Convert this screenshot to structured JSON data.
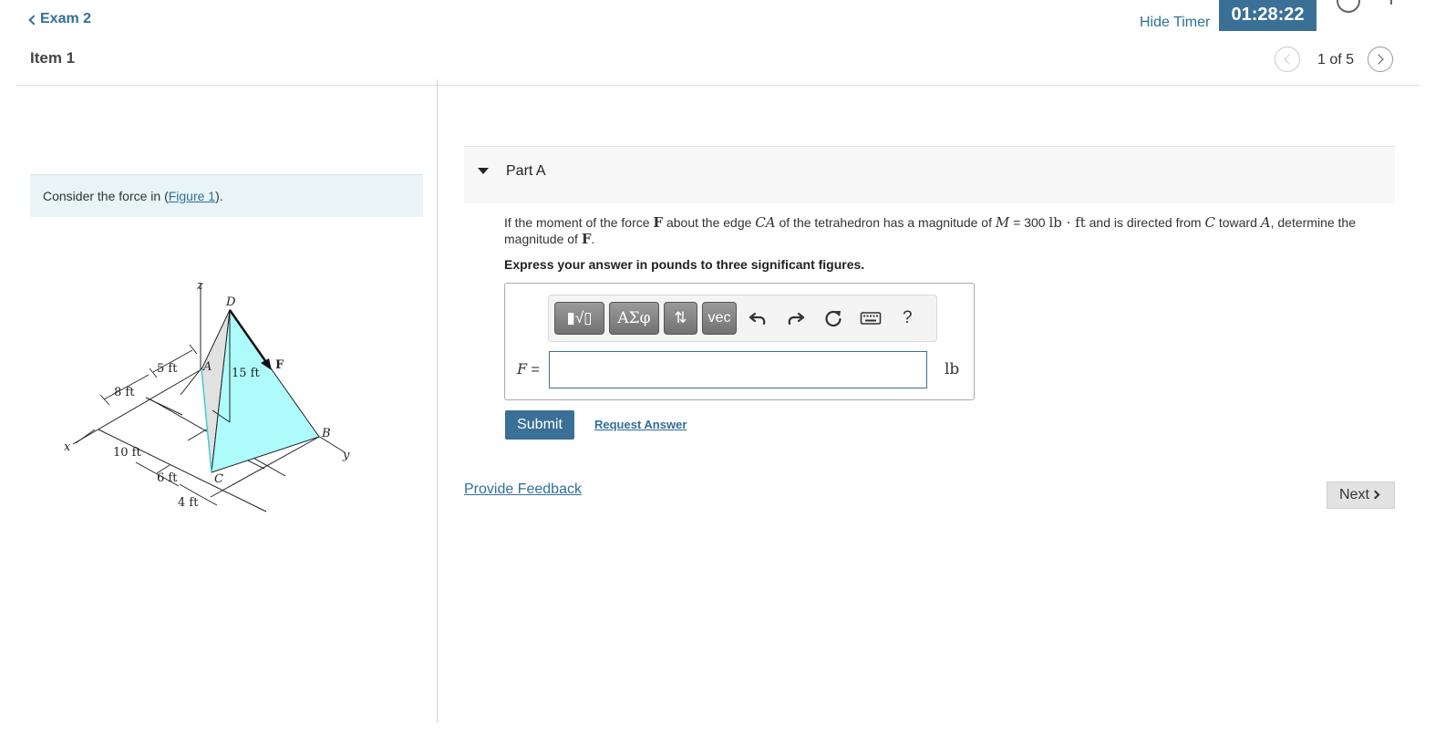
{
  "header": {
    "back_label": "Exam 2",
    "item_title": "Item 1",
    "hide_timer": "Hide Timer",
    "timer": "01:28:22",
    "pager": "1 of 5"
  },
  "intro": {
    "prefix": "Consider the force in (",
    "figure_link": "Figure 1",
    "suffix": ")."
  },
  "figure": {
    "labels": {
      "z": "z",
      "D": "D",
      "A": "A",
      "F": "F",
      "B": "B",
      "C": "C",
      "x": "x",
      "y": "y",
      "d5": "5 ft",
      "d15": "15 ft",
      "d8": "8 ft",
      "d10": "10 ft",
      "d6": "6 ft",
      "d4": "4 ft"
    },
    "colors": {
      "face": "#aefbfb",
      "face_left": "#e1e1e1"
    }
  },
  "part": {
    "label": "Part A"
  },
  "question": {
    "t1": "If the moment of the force ",
    "F": "F",
    "t2": " about the edge ",
    "CA": "CA",
    "t3": " of the tetrahedron has a magnitude of ",
    "M": "M",
    "t4": " = 300 ",
    "unit": "lb · ft",
    "t5": " and is directed from ",
    "C": "C",
    "t6": " toward ",
    "A": "A",
    "t7": ", determine the magnitude of ",
    "F2": "F",
    "t8": "."
  },
  "instruction": "Express your answer in pounds to three significant figures.",
  "answer": {
    "toolbar": {
      "templates": "▮√▯",
      "greek": "ΑΣφ",
      "arrows": "⇅",
      "vec": "vec",
      "help": "?"
    },
    "var_label": "F",
    "eq": " =",
    "value": "",
    "unit": "lb"
  },
  "actions": {
    "submit": "Submit",
    "request": "Request Answer",
    "feedback": "Provide Feedback",
    "next": "Next"
  }
}
